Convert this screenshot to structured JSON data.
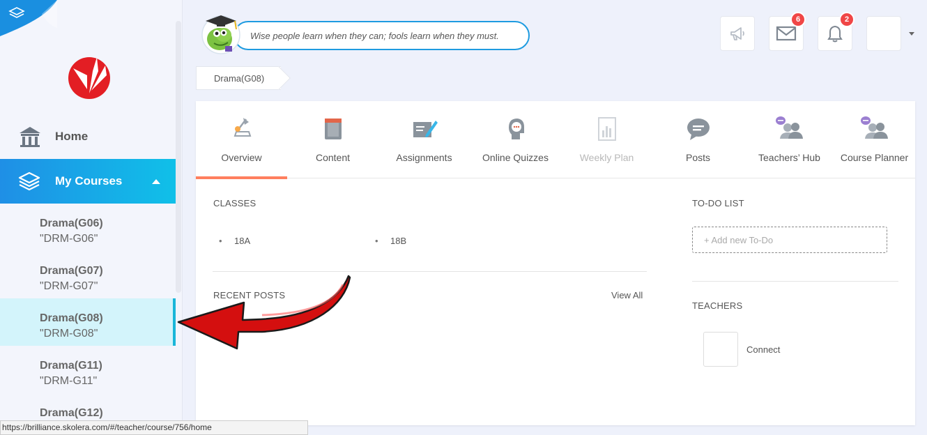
{
  "sidebar": {
    "home_label": "Home",
    "my_courses_label": "My Courses",
    "courses": [
      {
        "name": "Drama(G06)",
        "code": "\"DRM-G06\""
      },
      {
        "name": "Drama(G07)",
        "code": "\"DRM-G07\""
      },
      {
        "name": "Drama(G08)",
        "code": "\"DRM-G08\""
      },
      {
        "name": "Drama(G11)",
        "code": "\"DRM-G11\""
      },
      {
        "name": "Drama(G12)",
        "code": ""
      }
    ],
    "active_course_index": 2
  },
  "header": {
    "quote": "Wise people learn when they can; fools learn when they must.",
    "messages_badge": "6",
    "notifications_badge": "2"
  },
  "breadcrumb": "Drama(G08)",
  "tabs": [
    {
      "label": "Overview",
      "icon": "lamp-icon",
      "active": true
    },
    {
      "label": "Content",
      "icon": "book-icon"
    },
    {
      "label": "Assignments",
      "icon": "pencil-board-icon"
    },
    {
      "label": "Online Quizzes",
      "icon": "head-chat-icon"
    },
    {
      "label": "Weekly Plan",
      "icon": "calendar-chart-icon",
      "disabled": true
    },
    {
      "label": "Posts",
      "icon": "speech-bubble-icon"
    },
    {
      "label": "Teachers’ Hub",
      "icon": "people-chat-icon"
    },
    {
      "label": "Course Planner",
      "icon": "people-chat-icon"
    }
  ],
  "main": {
    "classes_title": "CLASSES",
    "classes": [
      "18A",
      "18B"
    ],
    "recent_posts_title": "RECENT POSTS",
    "view_all": "View All",
    "todo_title": "TO-DO LIST",
    "todo_placeholder": "+ Add new To-Do",
    "teachers_title": "TEACHERS",
    "teacher_connect": "Connect"
  },
  "status_url": "https://brilliance.skolera.com/#/teacher/course/756/home",
  "colors": {
    "accent_gradient_start": "#1f8fe6",
    "accent_gradient_end": "#10c0e8",
    "active_tab_underline": "#ff7f5e",
    "badge": "#f04646",
    "active_course_bg": "#d3f4fb",
    "arrow": "#d40f0f"
  }
}
